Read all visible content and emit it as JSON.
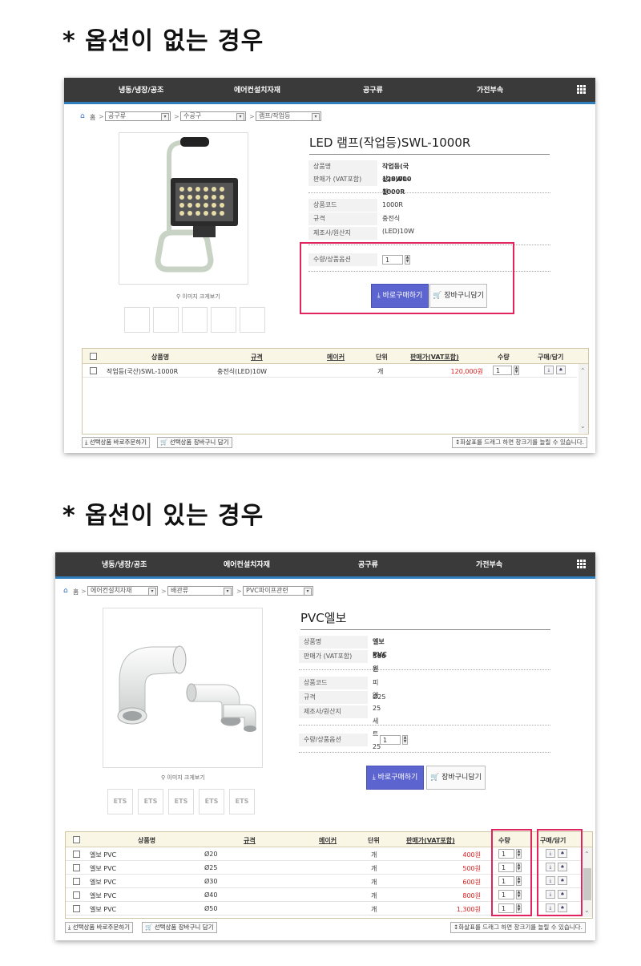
{
  "sections": [
    {
      "heading": "* 옵션이 없는 경우",
      "nav": [
        "냉동/냉장/공조",
        "에어컨설치자재",
        "공구류",
        "가전부속"
      ],
      "breadcrumb": {
        "home": "홈",
        "selects": [
          "공구류",
          "수공구",
          "램프/작업등"
        ]
      },
      "zoom_label": "이미지 크게보기",
      "product": {
        "title": "LED 램프(작업등)SWL-1000R",
        "name_label": "상품명",
        "name": "작업등(국산)SWL-1000R",
        "price_label": "판매가 (VAT포함)",
        "price": "120,000원",
        "code_label": "상품코드",
        "code": "1000R",
        "spec_label": "규격",
        "spec": "충전식(LED)10W",
        "maker_label": "제조사/원산지",
        "maker": "",
        "qty_label": "수량/상품옵션",
        "qty": "1"
      },
      "buy_label": "바로구매하기",
      "cart_label": "장바구니담기",
      "table": {
        "headers": [
          "상품명",
          "규격",
          "메이커",
          "단위",
          "판매가(VAT포함)",
          "수량",
          "구매/담기"
        ],
        "rows": [
          {
            "name": "작업등(국산)SWL-1000R",
            "spec": "충전식(LED)10W",
            "unit": "개",
            "price": "120,000원",
            "qty": "1"
          }
        ]
      },
      "footer": {
        "buy_selected": "선택상품 바로주문하기",
        "cart_selected": "선택상품 장바구니 담기",
        "hint": "화살표를 드래그 하면 창크기를 늘릴 수 있습니다."
      }
    },
    {
      "heading": "* 옵션이 있는 경우",
      "nav": [
        "냉동/냉장/공조",
        "에어컨설치자재",
        "공구류",
        "가전부속"
      ],
      "breadcrumb": {
        "home": "홈",
        "selects": [
          "에어컨설치자재",
          "배관류",
          "PVC파이프관련"
        ]
      },
      "zoom_label": "이미지 크게보기",
      "thumb_text": "ETS",
      "product": {
        "title": "PVC엘보",
        "name_label": "상품명",
        "name": "엘보 PVC",
        "price_label": "판매가 (VAT포함)",
        "price": "500원",
        "code_label": "상품코드",
        "code": "피엘25 세트25",
        "spec_label": "규격",
        "spec": "Ø25",
        "maker_label": "제조사/원산지",
        "maker": "",
        "qty_label": "수량/상품옵션",
        "qty": "1"
      },
      "buy_label": "바로구매하기",
      "cart_label": "장바구니담기",
      "table": {
        "headers": [
          "상품명",
          "규격",
          "메이커",
          "단위",
          "판매가(VAT포함)",
          "수량",
          "구매/담기"
        ],
        "rows": [
          {
            "name": "엘보 PVC",
            "spec": "Ø20",
            "unit": "개",
            "price": "400원",
            "qty": "1"
          },
          {
            "name": "엘보 PVC",
            "spec": "Ø25",
            "unit": "개",
            "price": "500원",
            "qty": "1"
          },
          {
            "name": "엘보 PVC",
            "spec": "Ø30",
            "unit": "개",
            "price": "600원",
            "qty": "1"
          },
          {
            "name": "엘보 PVC",
            "spec": "Ø40",
            "unit": "개",
            "price": "800원",
            "qty": "1"
          },
          {
            "name": "엘보 PVC",
            "spec": "Ø50",
            "unit": "개",
            "price": "1,300원",
            "qty": "1"
          }
        ]
      },
      "footer": {
        "buy_selected": "선택상품 바로주문하기",
        "cart_selected": "선택상품 장바구니 담기",
        "hint": "화살표를 드래그 하면 창크기를 늘릴 수 있습니다."
      }
    }
  ],
  "colors": {
    "nav_bg": "#3a3a3a",
    "nav_accent": "#2f7fbf",
    "buy_button": "#5c64cf",
    "highlight": "#e0245e",
    "price": "#e02020"
  }
}
